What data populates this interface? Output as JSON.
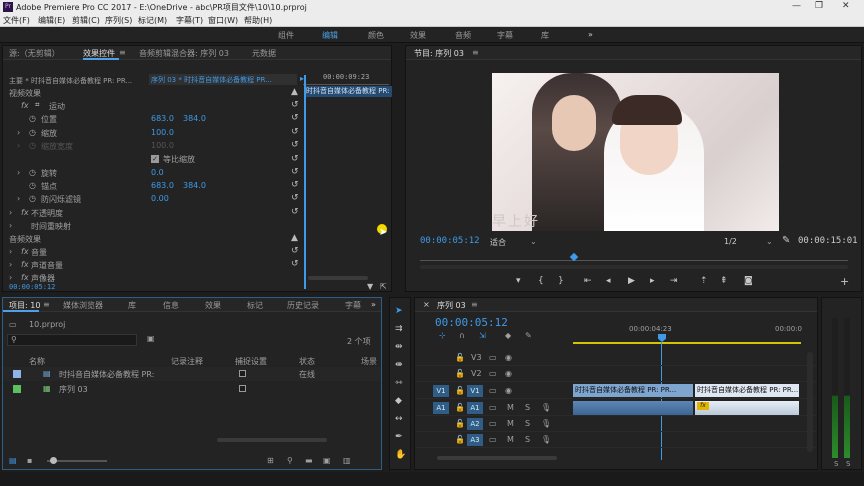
{
  "window": {
    "title": "Adobe Premiere Pro CC 2017 - E:\\OneDrive - abc\\PR项目文件\\10\\10.prproj",
    "logo": "Pr",
    "minimize_glyph": "—",
    "maximize_glyph": "❐",
    "close_glyph": "✕"
  },
  "menu": [
    "文件(F)",
    "编辑(E)",
    "剪辑(C)",
    "序列(S)",
    "标记(M)",
    "字幕(T)",
    "窗口(W)",
    "帮助(H)"
  ],
  "workspaces": {
    "items": [
      "组件",
      "编辑",
      "颜色",
      "效果",
      "音频",
      "字幕",
      "库"
    ],
    "active": "编辑",
    "more": "»"
  },
  "source_panel": {
    "tabs": [
      "源:（无剪辑）",
      "效果控件",
      "音频剪辑混合器: 序列 03",
      "元数据"
    ],
    "active_tab": "效果控件",
    "tab_menu": "≡",
    "master_label": "主要 * 时抖音自媒体必备教程 PR: PR...",
    "sequence_label": "序列 03 * 时抖音自媒体必备教程 PR...",
    "timecode_mini": "00:00:09:23",
    "mini_clip": "时抖音自媒体必备教程 PR:",
    "video_effects": "视频效果",
    "motion": "运动",
    "position_label": "位置",
    "position_x": "683.0",
    "position_y": "384.0",
    "scale_label": "缩放",
    "scale_value": "100.0",
    "scale_width_label": "缩放宽度",
    "scale_width_value": "100.0",
    "uniform_scale": "等比缩放",
    "rotation_label": "旋转",
    "rotation_value": "0.0",
    "anchor_label": "锚点",
    "anchor_x": "683.0",
    "anchor_y": "384.0",
    "flicker_label": "防闪烁滤镜",
    "flicker_value": "0.00",
    "opacity": "不透明度",
    "time_remap": "时间重映射",
    "audio_effects": "音频效果",
    "volume": "音量",
    "channel_volume": "声道音量",
    "panner": "声像器",
    "timecode": "00:00:05:12"
  },
  "program_panel": {
    "title": "节目: 序列 03",
    "menu_glyph": "≡",
    "timecode_current": "00:00:05:12",
    "fit_label": "适合",
    "resolution": "1/2",
    "timecode_total": "00:00:15:01",
    "watermark": "早上好"
  },
  "project_panel": {
    "tabs": [
      "项目: 10",
      "媒体浏览器",
      "库",
      "信息",
      "效果",
      "标记",
      "历史记录",
      "字幕"
    ],
    "active_tab": "项目: 10",
    "tab_menu": "≡",
    "more": "»",
    "file": "10.prproj",
    "item_count": "2 个项",
    "columns": [
      "名称",
      "记录注释",
      "捕捉设置",
      "状态",
      "场景"
    ],
    "rows": [
      {
        "name": "时抖音自媒体必备教程 PR:",
        "status": "在线",
        "color": "#8fb4e8"
      },
      {
        "name": "序列 03",
        "status": "",
        "color": "#5cc05c"
      }
    ]
  },
  "timeline_panel": {
    "title": "序列 03",
    "close_glyph": "×",
    "menu_glyph": "≡",
    "timecode": "00:00:05:12",
    "ruler_time": "00:00:04:23",
    "ruler_time_right": "00:00:0",
    "tracks": [
      {
        "src": "",
        "name": "V3",
        "type": "video"
      },
      {
        "src": "",
        "name": "V2",
        "type": "video"
      },
      {
        "src": "V1",
        "name": "V1",
        "type": "video"
      },
      {
        "src": "A1",
        "name": "A1",
        "type": "audio"
      },
      {
        "src": "",
        "name": "A2",
        "type": "audio"
      },
      {
        "src": "",
        "name": "A3",
        "type": "audio"
      }
    ],
    "mute": "M",
    "solo": "S",
    "clip_a": "时抖音自媒体必备教程 PR: PR...",
    "clip_b": "时抖音自媒体必备教程 PR: PR...",
    "fx_badge": "fx"
  }
}
